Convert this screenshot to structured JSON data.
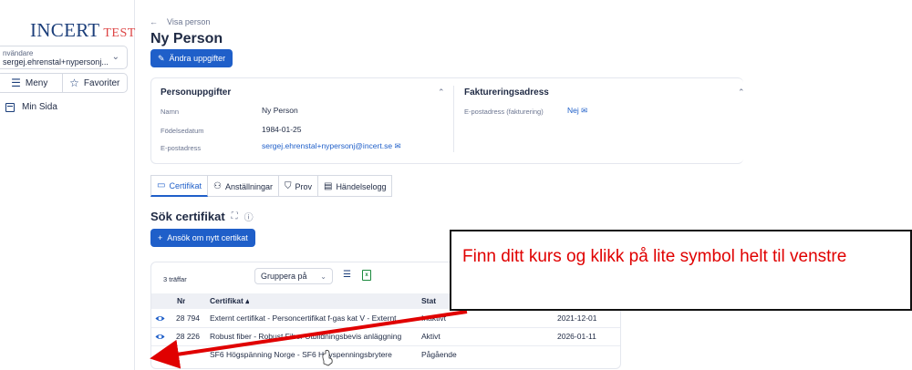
{
  "sidebar": {
    "logo_main": "INCERT",
    "logo_sub": "TEST",
    "user_label": "nvändare",
    "user_value": "sergej.ehrenstal+nypersonj...",
    "menu_label": "Meny",
    "favorites_label": "Favoriter",
    "nav_item": "Min Sida"
  },
  "header": {
    "breadcrumb": "Visa person",
    "title": "Ny Person",
    "edit_button": "Ändra uppgifter"
  },
  "personal": {
    "heading": "Personuppgifter",
    "name_label": "Namn",
    "name_value": "Ny Person",
    "dob_label": "Födelsedatum",
    "dob_value": "1984-01-25",
    "email_label": "E-postadress",
    "email_value": "sergej.ehrenstal+nypersonj@incert.se"
  },
  "billing": {
    "heading": "Faktureringsadress",
    "email_label": "E-postadress (fakturering)",
    "email_value": "Nej"
  },
  "tabs": [
    "Certifikat",
    "Anställningar",
    "Prov",
    "Händelselogg"
  ],
  "search": {
    "heading": "Sök certifikat",
    "apply_button": "Ansök om nytt certikat"
  },
  "results": {
    "hits": "3 träffar",
    "group_by": "Gruppera på",
    "columns": {
      "nr": "Nr",
      "cert": "Certifikat ▴",
      "status": "Stat"
    },
    "rows": [
      {
        "nr": "28 794",
        "cert": "Externt certifikat - Personcertifikat f-gas kat V - Externt",
        "status": "Inaktivt",
        "date": "2021-12-01"
      },
      {
        "nr": "28 226",
        "cert": "Robust fiber - Robust Fiber Utbildningsbevis anläggning",
        "status": "Aktivt",
        "date": "2026-01-11"
      },
      {
        "nr": "",
        "cert": "SF6 Högspänning Norge - SF6 Høyspenningsbrytere",
        "status": "Pågående",
        "date": ""
      }
    ]
  },
  "annotation": {
    "text": "Finn ditt kurs og klikk på lite symbol helt til venstre"
  },
  "colors": {
    "primary": "#1f5fc9",
    "annotation": "#e00000",
    "logo": "#1b3e7a"
  }
}
